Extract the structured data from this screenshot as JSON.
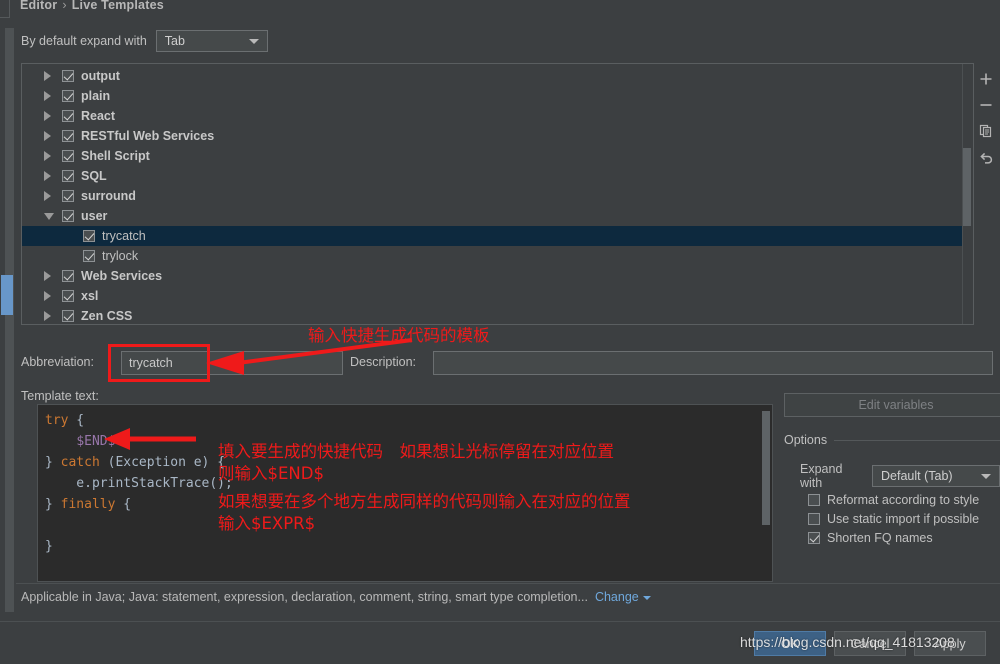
{
  "breadcrumb": {
    "parent": "Editor",
    "separator": "›",
    "current": "Live Templates"
  },
  "expand_default": {
    "label": "By default expand with",
    "value": "Tab"
  },
  "tree": {
    "items": [
      {
        "label": "output",
        "type": "group",
        "expanded": false,
        "checked": true,
        "selected": false
      },
      {
        "label": "plain",
        "type": "group",
        "expanded": false,
        "checked": true,
        "selected": false
      },
      {
        "label": "React",
        "type": "group",
        "expanded": false,
        "checked": true,
        "selected": false
      },
      {
        "label": "RESTful Web Services",
        "type": "group",
        "expanded": false,
        "checked": true,
        "selected": false
      },
      {
        "label": "Shell Script",
        "type": "group",
        "expanded": false,
        "checked": true,
        "selected": false
      },
      {
        "label": "SQL",
        "type": "group",
        "expanded": false,
        "checked": true,
        "selected": false
      },
      {
        "label": "surround",
        "type": "group",
        "expanded": false,
        "checked": true,
        "selected": false
      },
      {
        "label": "user",
        "type": "group",
        "expanded": true,
        "checked": true,
        "selected": false
      },
      {
        "label": "trycatch",
        "type": "leaf",
        "expanded": false,
        "checked": true,
        "selected": true
      },
      {
        "label": "trylock",
        "type": "leaf",
        "expanded": false,
        "checked": true,
        "selected": false
      },
      {
        "label": "Web Services",
        "type": "group",
        "expanded": false,
        "checked": true,
        "selected": false
      },
      {
        "label": "xsl",
        "type": "group",
        "expanded": false,
        "checked": true,
        "selected": false
      },
      {
        "label": "Zen CSS",
        "type": "group",
        "expanded": false,
        "checked": true,
        "selected": false
      }
    ]
  },
  "toolbar": {
    "add": "add-icon",
    "remove": "remove-icon",
    "duplicate": "copy-icon",
    "revert": "undo-icon"
  },
  "abbreviation": {
    "label": "Abbreviation:",
    "value": "trycatch",
    "placeholder": ""
  },
  "description": {
    "label": "Description:",
    "value": "",
    "placeholder": ""
  },
  "template_text": {
    "label": "Template text:",
    "lines": [
      {
        "segments": [
          {
            "t": "try",
            "c": "k"
          },
          {
            "t": " {",
            "c": "p"
          }
        ]
      },
      {
        "segments": [
          {
            "t": "    ",
            "c": "p"
          },
          {
            "t": "$END$",
            "c": "v"
          }
        ]
      },
      {
        "segments": [
          {
            "t": "} ",
            "c": "p"
          },
          {
            "t": "catch",
            "c": "k"
          },
          {
            "t": " (Exception e) {",
            "c": "p"
          }
        ]
      },
      {
        "segments": [
          {
            "t": "    e.printStackTrace();",
            "c": "p"
          }
        ]
      },
      {
        "segments": [
          {
            "t": "} ",
            "c": "p"
          },
          {
            "t": "finally",
            "c": "k"
          },
          {
            "t": " {",
            "c": "p"
          }
        ]
      },
      {
        "segments": [
          {
            "t": "",
            "c": "p"
          }
        ]
      },
      {
        "segments": [
          {
            "t": "}",
            "c": "p"
          }
        ]
      }
    ],
    "plain": "try {\n    $END$\n} catch (Exception e) {\n    e.printStackTrace();\n} finally {\n\n}"
  },
  "edit_variables": {
    "label": "Edit variables",
    "enabled": false
  },
  "options": {
    "title": "Options",
    "expand_with": {
      "label": "Expand with",
      "value": "Default (Tab)"
    },
    "checkboxes": [
      {
        "label": "Reformat according to style",
        "checked": false
      },
      {
        "label": "Use static import if possible",
        "checked": false
      },
      {
        "label": "Shorten FQ names",
        "checked": true
      }
    ]
  },
  "applicable": {
    "text": "Applicable in Java; Java: statement, expression, declaration, comment, string, smart type completion...",
    "change_label": "Change"
  },
  "dialog_buttons": {
    "ok": "OK",
    "cancel": "Cancel",
    "apply": "Apply"
  },
  "annotations": {
    "note_top": "输入快捷生成代码的模板",
    "note_line1": "填入要生成的快捷代码　如果想让光标停留在对应位置",
    "note_line2": "则输入$END$",
    "note_line3": "如果想要在多个地方生成同样的代码则输入在对应的位置",
    "note_line4": "输入$EXPR$",
    "color": "#ef1a1a"
  },
  "watermark": {
    "text": "https://blog.csdn.net/qq_41813208"
  }
}
